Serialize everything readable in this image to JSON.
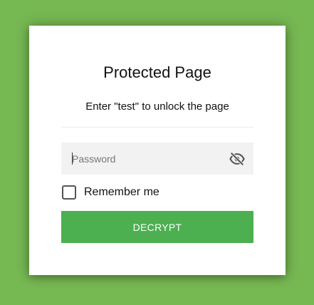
{
  "page": {
    "title": "Protected Page",
    "instructions": "Enter \"test\" to unlock the page"
  },
  "form": {
    "password": {
      "value": "",
      "placeholder": "Password",
      "toggle_icon": "eye-slash-icon"
    },
    "remember": {
      "label": "Remember me",
      "checked": false
    },
    "submit_label": "DECRYPT"
  },
  "colors": {
    "background": "#76b852",
    "button": "#4caf50",
    "input_background": "#f2f2f2"
  }
}
